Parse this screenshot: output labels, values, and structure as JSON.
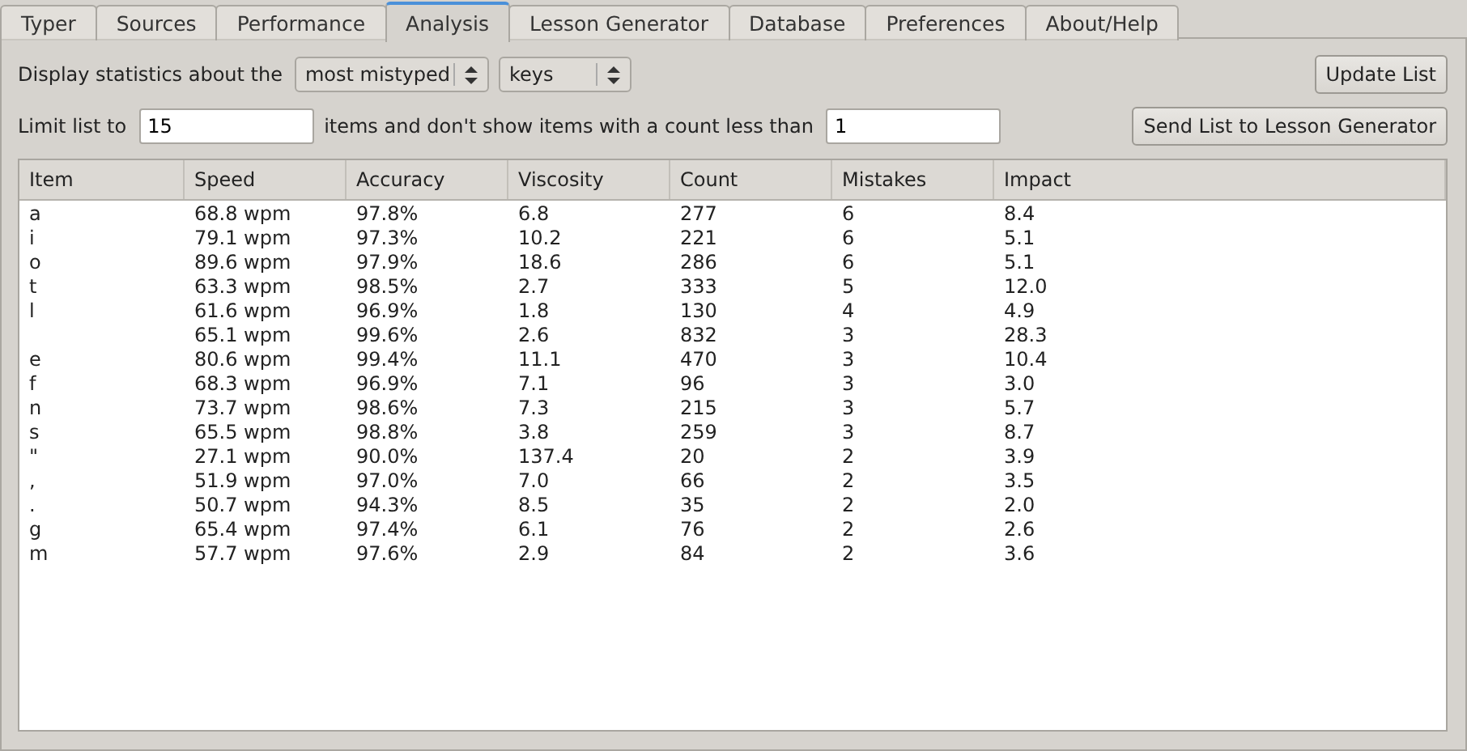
{
  "tabs": [
    {
      "label": "Typer",
      "selected": false
    },
    {
      "label": "Sources",
      "selected": false
    },
    {
      "label": "Performance",
      "selected": false
    },
    {
      "label": "Analysis",
      "selected": true
    },
    {
      "label": "Lesson Generator",
      "selected": false
    },
    {
      "label": "Database",
      "selected": false
    },
    {
      "label": "Preferences",
      "selected": false
    },
    {
      "label": "About/Help",
      "selected": false
    }
  ],
  "controls": {
    "display_label": "Display statistics about the",
    "order_select": "most mistyped",
    "kind_select": "keys",
    "update_button": "Update List",
    "limit_label": "Limit list to",
    "limit_value": "15",
    "count_label": "items and don't show items with a count less than",
    "min_count_value": "1",
    "send_button": "Send List to Lesson Generator"
  },
  "table": {
    "columns": [
      "Item",
      "Speed",
      "Accuracy",
      "Viscosity",
      "Count",
      "Mistakes",
      "Impact"
    ],
    "rows": [
      [
        "a",
        "68.8 wpm",
        "97.8%",
        "6.8",
        "277",
        "6",
        "8.4"
      ],
      [
        "i",
        "79.1 wpm",
        "97.3%",
        "10.2",
        "221",
        "6",
        "5.1"
      ],
      [
        "o",
        "89.6 wpm",
        "97.9%",
        "18.6",
        "286",
        "6",
        "5.1"
      ],
      [
        "t",
        "63.3 wpm",
        "98.5%",
        "2.7",
        "333",
        "5",
        "12.0"
      ],
      [
        "l",
        "61.6 wpm",
        "96.9%",
        "1.8",
        "130",
        "4",
        "4.9"
      ],
      [
        "",
        "65.1 wpm",
        "99.6%",
        "2.6",
        "832",
        "3",
        "28.3"
      ],
      [
        "e",
        "80.6 wpm",
        "99.4%",
        "11.1",
        "470",
        "3",
        "10.4"
      ],
      [
        "f",
        "68.3 wpm",
        "96.9%",
        "7.1",
        "96",
        "3",
        "3.0"
      ],
      [
        "n",
        "73.7 wpm",
        "98.6%",
        "7.3",
        "215",
        "3",
        "5.7"
      ],
      [
        "s",
        "65.5 wpm",
        "98.8%",
        "3.8",
        "259",
        "3",
        "8.7"
      ],
      [
        "\"",
        "27.1 wpm",
        "90.0%",
        "137.4",
        "20",
        "2",
        "3.9"
      ],
      [
        ",",
        "51.9 wpm",
        "97.0%",
        "7.0",
        "66",
        "2",
        "3.5"
      ],
      [
        ".",
        "50.7 wpm",
        "94.3%",
        "8.5",
        "35",
        "2",
        "2.0"
      ],
      [
        "g",
        "65.4 wpm",
        "97.4%",
        "6.1",
        "76",
        "2",
        "2.6"
      ],
      [
        "m",
        "57.7 wpm",
        "97.6%",
        "2.9",
        "84",
        "2",
        "3.6"
      ]
    ]
  }
}
